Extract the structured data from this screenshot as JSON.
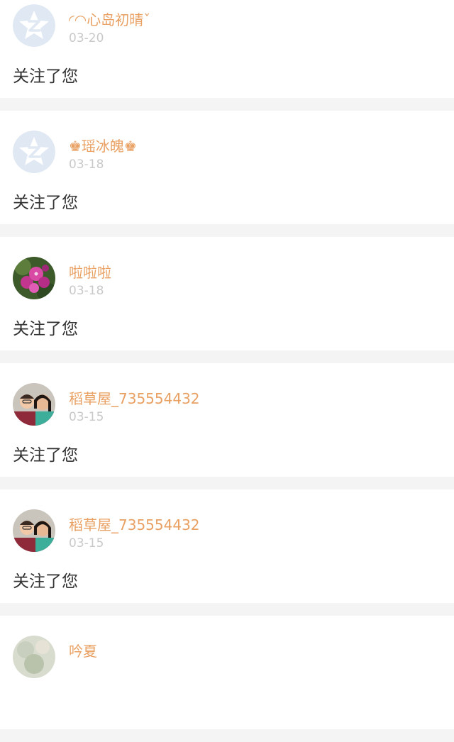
{
  "colors": {
    "background": "#f4f4f4",
    "card": "#ffffff",
    "name": "#e9a063",
    "date": "#c9c9c9",
    "text": "#333333"
  },
  "notifications": [
    {
      "name": "◜◠心岛初晴ˇ",
      "date": "03-20",
      "message": "关注了您",
      "avatar": "qq-default-avatar-icon"
    },
    {
      "name": "♚瑶冰魄♚",
      "date": "03-18",
      "message": "关注了您",
      "avatar": "qq-default-avatar-icon"
    },
    {
      "name": "啦啦啦",
      "date": "03-18",
      "message": "关注了您",
      "avatar": "flower-photo-avatar"
    },
    {
      "name": "稻草屋_735554432",
      "date": "03-15",
      "message": "关注了您",
      "avatar": "family-photo-avatar"
    },
    {
      "name": "稻草屋_735554432",
      "date": "03-15",
      "message": "关注了您",
      "avatar": "family-photo-avatar"
    },
    {
      "name": "吟夏",
      "date": "",
      "message": "",
      "avatar": "photo-avatar"
    }
  ]
}
